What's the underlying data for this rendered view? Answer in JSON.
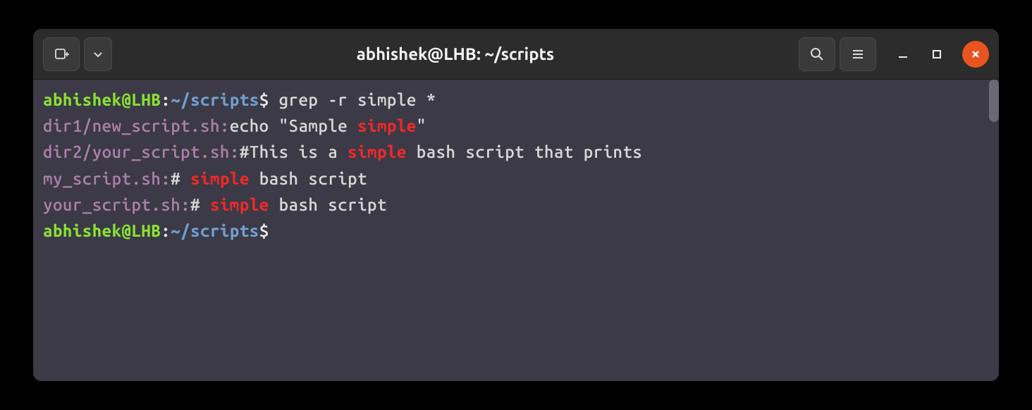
{
  "titlebar": {
    "title": "abhishek@LHB: ~/scripts"
  },
  "terminal": {
    "prompt1": {
      "user": "abhishek@LHB",
      "sep1": ":",
      "path": "~/scripts",
      "sep2": "$",
      "cmd": " grep -r simple *"
    },
    "line1": {
      "file": "dir1/new_script.sh:",
      "text1": "echo \"Sample ",
      "match": "simple",
      "text2": "\""
    },
    "line2": {
      "file": "dir2/your_script.sh:",
      "text1": "#This is a ",
      "match": "simple",
      "text2": " bash script that prints"
    },
    "line3": {
      "file": "my_script.sh:",
      "text1": "# ",
      "match": "simple",
      "text2": " bash script"
    },
    "line4": {
      "file": "your_script.sh:",
      "text1": "# ",
      "match": "simple",
      "text2": " bash script"
    },
    "prompt2": {
      "user": "abhishek@LHB",
      "sep1": ":",
      "path": "~/scripts",
      "sep2": "$"
    }
  }
}
